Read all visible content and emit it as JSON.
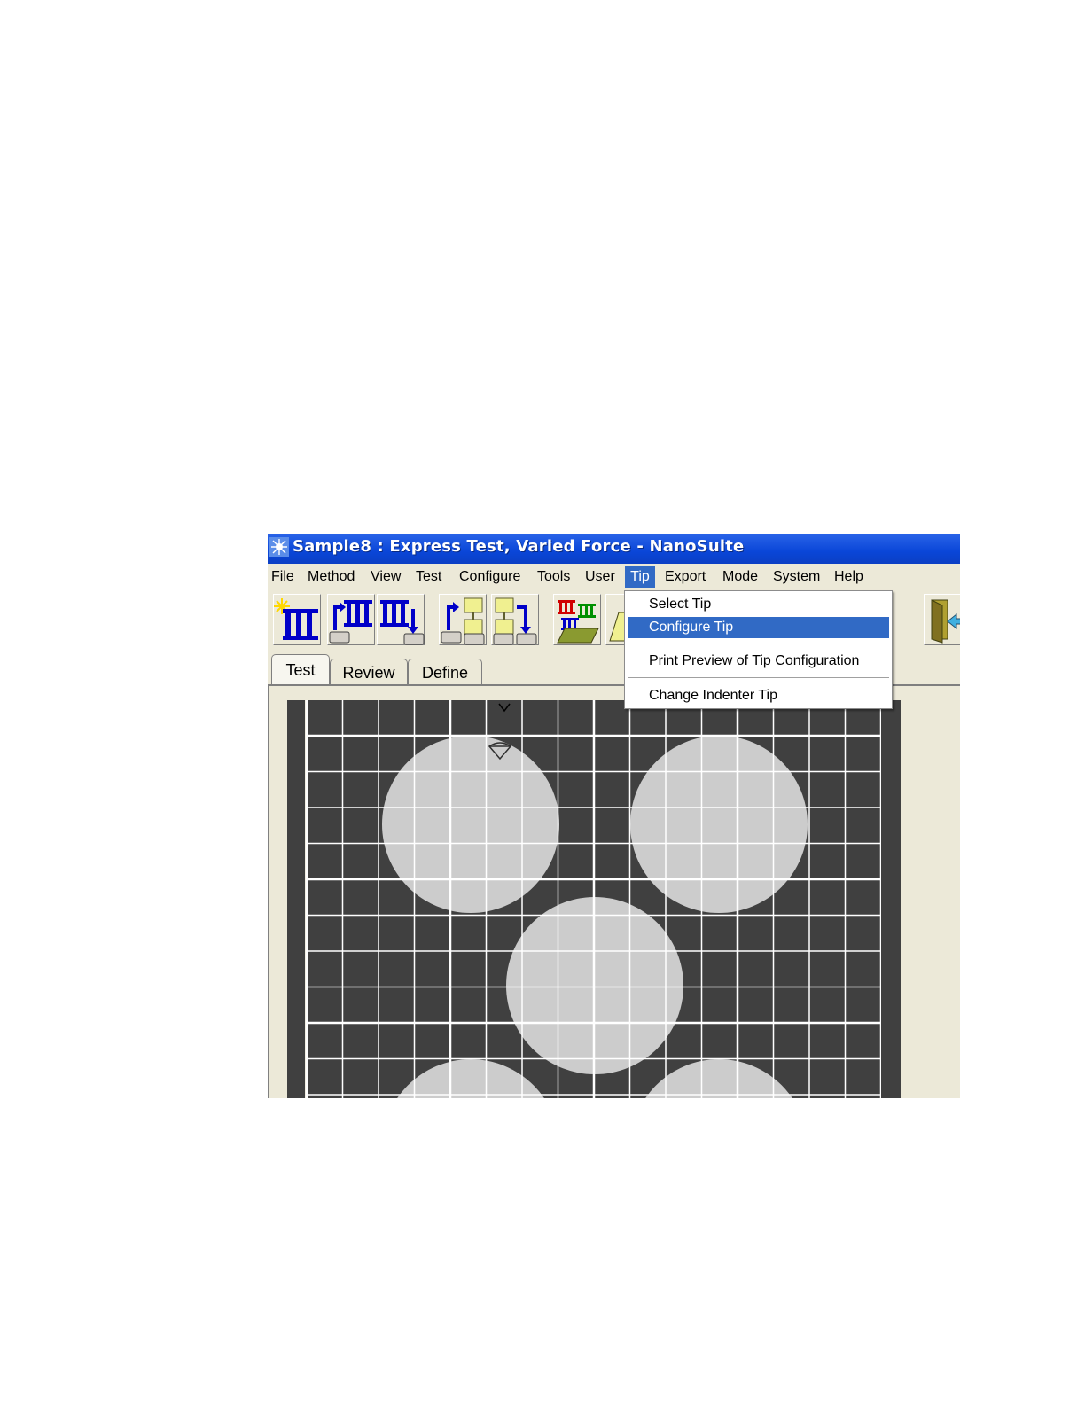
{
  "window": {
    "title": "Sample8 : Express Test, Varied Force - NanoSuite"
  },
  "menu_bar": {
    "items": [
      {
        "label": "File"
      },
      {
        "label": "Method"
      },
      {
        "label": "View"
      },
      {
        "label": "Test"
      },
      {
        "label": "Configure"
      },
      {
        "label": "Tools"
      },
      {
        "label": "User"
      },
      {
        "label": "Tip",
        "active": true
      },
      {
        "label": "Export"
      },
      {
        "label": "Mode"
      },
      {
        "label": "System"
      },
      {
        "label": "Help"
      }
    ]
  },
  "tip_menu": {
    "items": [
      {
        "label": "Select Tip"
      },
      {
        "label": "Configure Tip",
        "highlighted": true
      },
      {
        "label": "Print Preview of Tip Configuration"
      },
      {
        "label": "Change Indenter Tip"
      }
    ]
  },
  "tabs": [
    {
      "label": "Test",
      "selected": true
    },
    {
      "label": "Review"
    },
    {
      "label": "Define"
    }
  ],
  "toolbar": {
    "icons": [
      "new-method-icon",
      "open-method-icon",
      "save-method-icon",
      "open-sample-icon",
      "save-sample-icon",
      "run-tests-icon",
      "exit-icon"
    ]
  },
  "colors": {
    "title_bar": "#0a46d8",
    "menu_highlight": "#316ac5",
    "grid_background": "#404040",
    "sample_circle": "#cccccc",
    "toolbar_icon_blue": "#0000c8"
  }
}
